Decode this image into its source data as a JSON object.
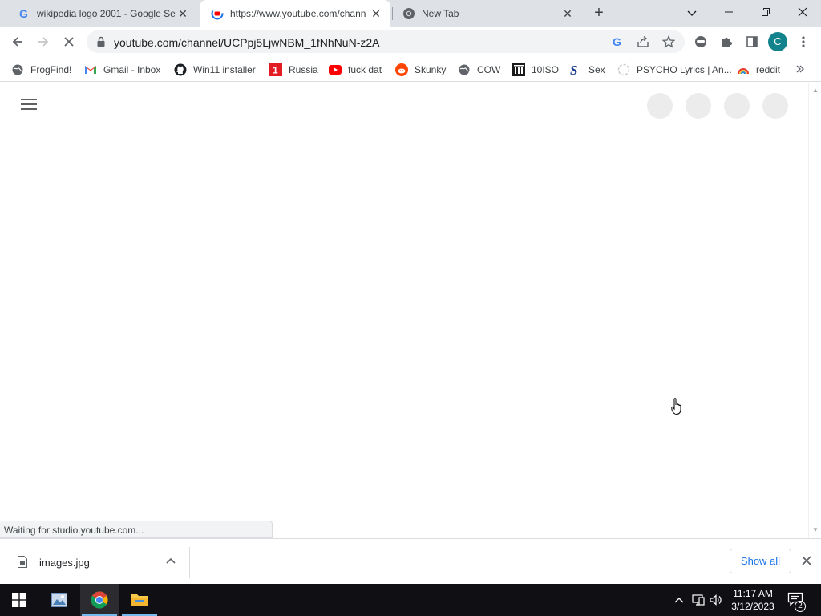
{
  "tabs": [
    {
      "title": "wikipedia logo 2001 - Google Se",
      "icon": "google-g-icon"
    },
    {
      "title": "https://www.youtube.com/chann",
      "icon": "youtube-loading-icon"
    },
    {
      "title": "New Tab",
      "icon": "chrome-icon"
    }
  ],
  "toolbar": {
    "url": "youtube.com/channel/UCPpj5LjwNBM_1fNhNuN-z2A",
    "profile_initial": "C"
  },
  "bookmarks": [
    {
      "label": "FrogFind!",
      "icon": "globe-icon"
    },
    {
      "label": "Gmail - Inbox",
      "icon": "gmail-icon"
    },
    {
      "label": "Win11 installer",
      "icon": "github-icon"
    },
    {
      "label": "Russia",
      "icon": "red-square-icon"
    },
    {
      "label": "fuck dat",
      "icon": "youtube-icon"
    },
    {
      "label": "Skunky",
      "icon": "reddit-icon"
    },
    {
      "label": "COW",
      "icon": "globe-icon"
    },
    {
      "label": "10ISO",
      "icon": "building-icon"
    },
    {
      "label": "Sex",
      "icon": "s-logo-icon"
    },
    {
      "label": "PSYCHO Lyrics | An...",
      "icon": "loading-circle-icon"
    },
    {
      "label": "reddit",
      "icon": "rainbow-icon"
    }
  ],
  "status_text": "Waiting for studio.youtube.com...",
  "download": {
    "filename": "images.jpg",
    "show_all_label": "Show all"
  },
  "taskbar": {
    "time": "11:17 AM",
    "date": "3/12/2023",
    "notification_count": "2"
  },
  "colors": {
    "tabstrip_bg": "#dee1e6",
    "accent_blue": "#1a73e8",
    "avatar_teal": "#12838c",
    "taskbar_bg": "#101014"
  }
}
